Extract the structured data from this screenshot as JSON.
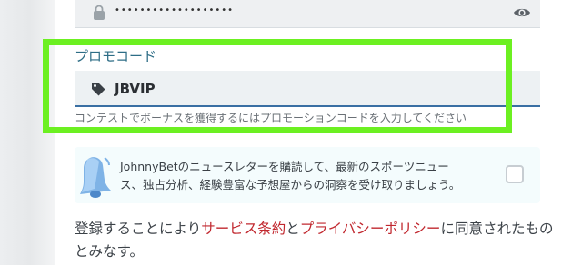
{
  "password": {
    "masked_value": "•••••••••••••••••••",
    "lock_icon": "lock-icon",
    "toggle_icon": "eye-icon"
  },
  "promo": {
    "label": "プロモコード",
    "value": "JBVIP",
    "hint": "コンテストでボーナスを獲得するにはプロモーションコードを入力してください",
    "tag_icon": "tag-icon",
    "highlight_color": "#6cf021"
  },
  "newsletter": {
    "text": "JohnnyBetのニュースレターを購読して、最新のスポーツニュース、独占分析、経験豊富な予想屋からの洞察を受け取りましょう。",
    "icon": "bell-icon",
    "checked": false
  },
  "agreement": {
    "prefix": "登録することにより",
    "terms_link": "サービス条約",
    "conjunction": "と",
    "privacy_link": "プライバシーポリシー",
    "suffix": "に同意されたものとみなす。"
  },
  "colors": {
    "accent_link": "#c1282f",
    "label_blue": "#2d6d86",
    "input_underline": "#3a6fa3"
  }
}
